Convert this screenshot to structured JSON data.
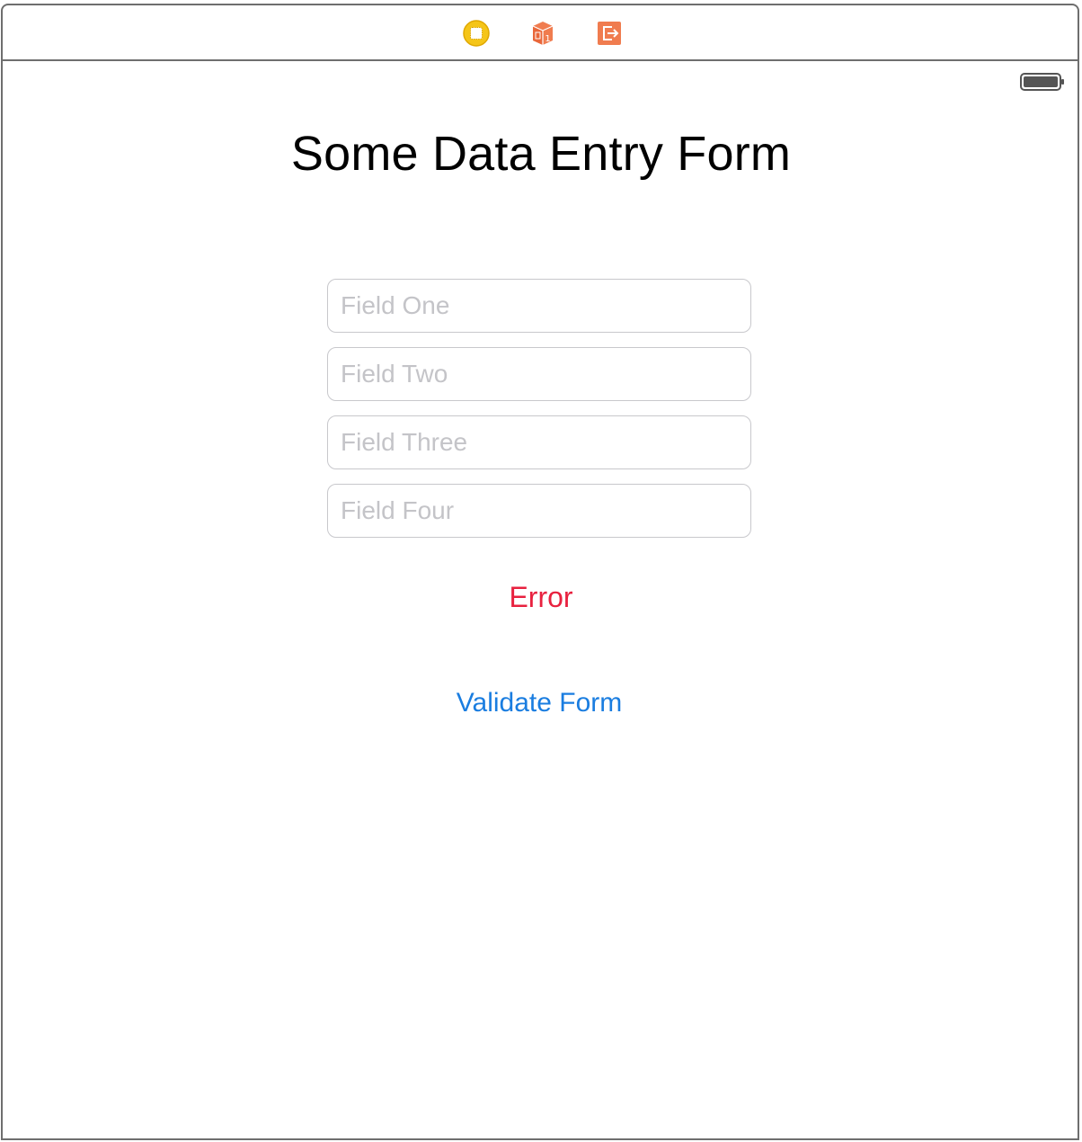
{
  "colors": {
    "error": "#e8213f",
    "accent": "#1a7de0",
    "placeholder": "#c4c4c8",
    "vc_icon": "#f5c518",
    "first_responder_icon": "#f07c4f",
    "exit_icon": "#f07c4f"
  },
  "dock": {
    "icons": [
      "view-controller-icon",
      "first-responder-icon",
      "exit-icon"
    ]
  },
  "status_bar": {
    "battery_level": 1.0
  },
  "form": {
    "title": "Some Data Entry Form",
    "fields": [
      {
        "placeholder": "Field One"
      },
      {
        "placeholder": "Field Two"
      },
      {
        "placeholder": "Field Three"
      },
      {
        "placeholder": "Field Four"
      }
    ],
    "error_label": "Error",
    "validate_button": "Validate Form"
  }
}
